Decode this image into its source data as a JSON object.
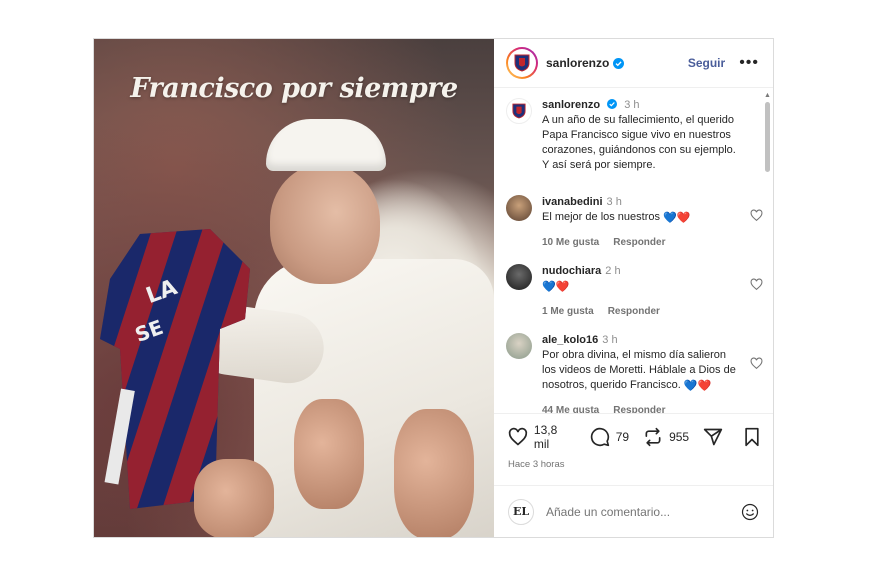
{
  "post": {
    "image_title": "Francisco por siempre",
    "header": {
      "username": "sanlorenzo",
      "follow_label": "Seguir",
      "more_label": "•••"
    },
    "caption": {
      "username": "sanlorenzo",
      "time": "3 h",
      "text": "A un año de su fallecimiento, el querido Papa Francisco sigue vivo en nuestros corazones, guiándonos con su ejemplo. Y así será por siempre."
    },
    "comments": [
      {
        "username": "ivanabedini",
        "time": "3 h",
        "text": "El mejor de los nuestros",
        "emoji": "💙❤️",
        "likes": "10 Me gusta",
        "reply": "Responder"
      },
      {
        "username": "nudochiara",
        "time": "2 h",
        "text": "",
        "emoji": "💙❤️",
        "likes": "1 Me gusta",
        "reply": "Responder"
      },
      {
        "username": "ale_kolo16",
        "time": "3 h",
        "text": "Por obra divina, el mismo día salieron los videos de Moretti. Háblale a Dios de nosotros, querido Francisco.",
        "emoji": "💙❤️",
        "likes": "44 Me gusta",
        "reply": "Responder"
      }
    ],
    "actions": {
      "likes": "13,8 mil",
      "comments": "79",
      "reposts": "955"
    },
    "posted_ago": "Hace 3 horas",
    "add_comment": {
      "avatar_text": "EL",
      "placeholder": "Añade un comentario..."
    },
    "colors": {
      "follow": "#4a5d9a",
      "verified": "#0095f6",
      "heart_red": "#e0245e",
      "heart_blue": "#1d6fd6"
    }
  }
}
